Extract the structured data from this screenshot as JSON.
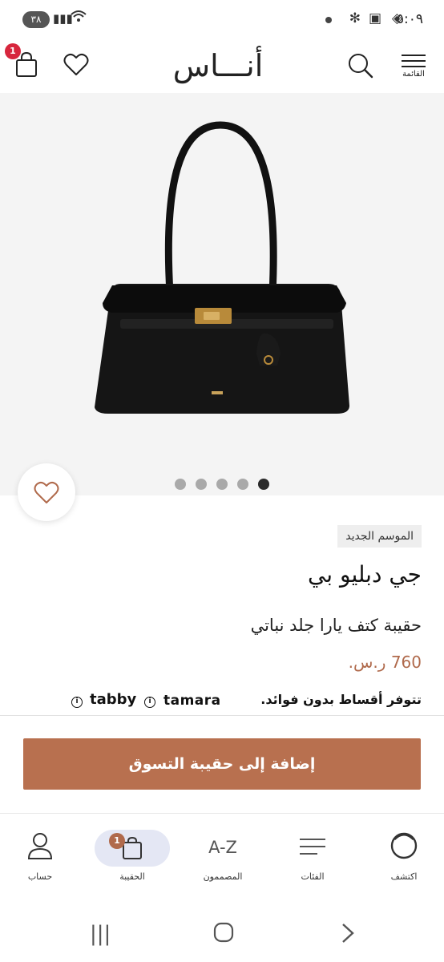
{
  "status_bar": {
    "time": "٥:٠٩",
    "battery": "٣٨"
  },
  "header": {
    "menu_label": "القائمة",
    "logo_text": "أنـــاس",
    "cart_count": "1"
  },
  "gallery": {
    "image_description": "black leather shoulder bag",
    "total_images": 5,
    "active_index": 4
  },
  "product": {
    "tag": "الموسم الجديد",
    "brand": "جي دبليو بي",
    "name": "حقيبة كتف يارا جلد نباتي",
    "price": "760 ر.س."
  },
  "installments": {
    "text": "تتوفر أقساط بدون فوائد.",
    "providers": [
      "tamara",
      "tabby"
    ],
    "info_glyph": "i"
  },
  "actions": {
    "add_to_bag": "إضافة إلى حقيبة التسوق"
  },
  "bottom_nav": {
    "items": [
      {
        "label": "اكتشف",
        "icon": "discover-circle-icon"
      },
      {
        "label": "الفئات",
        "icon": "categories-lines-icon"
      },
      {
        "label": "المصممون",
        "icon_text": "A-Z"
      },
      {
        "label": "الحقيبة",
        "icon": "bag-icon",
        "badge": "1",
        "active": true
      },
      {
        "label": "حساب",
        "icon": "user-icon"
      }
    ]
  },
  "colors": {
    "accent": "#b8704f",
    "price": "#b06a4c",
    "badge_red": "#d7263d",
    "active_pill": "#e4e7f4"
  }
}
